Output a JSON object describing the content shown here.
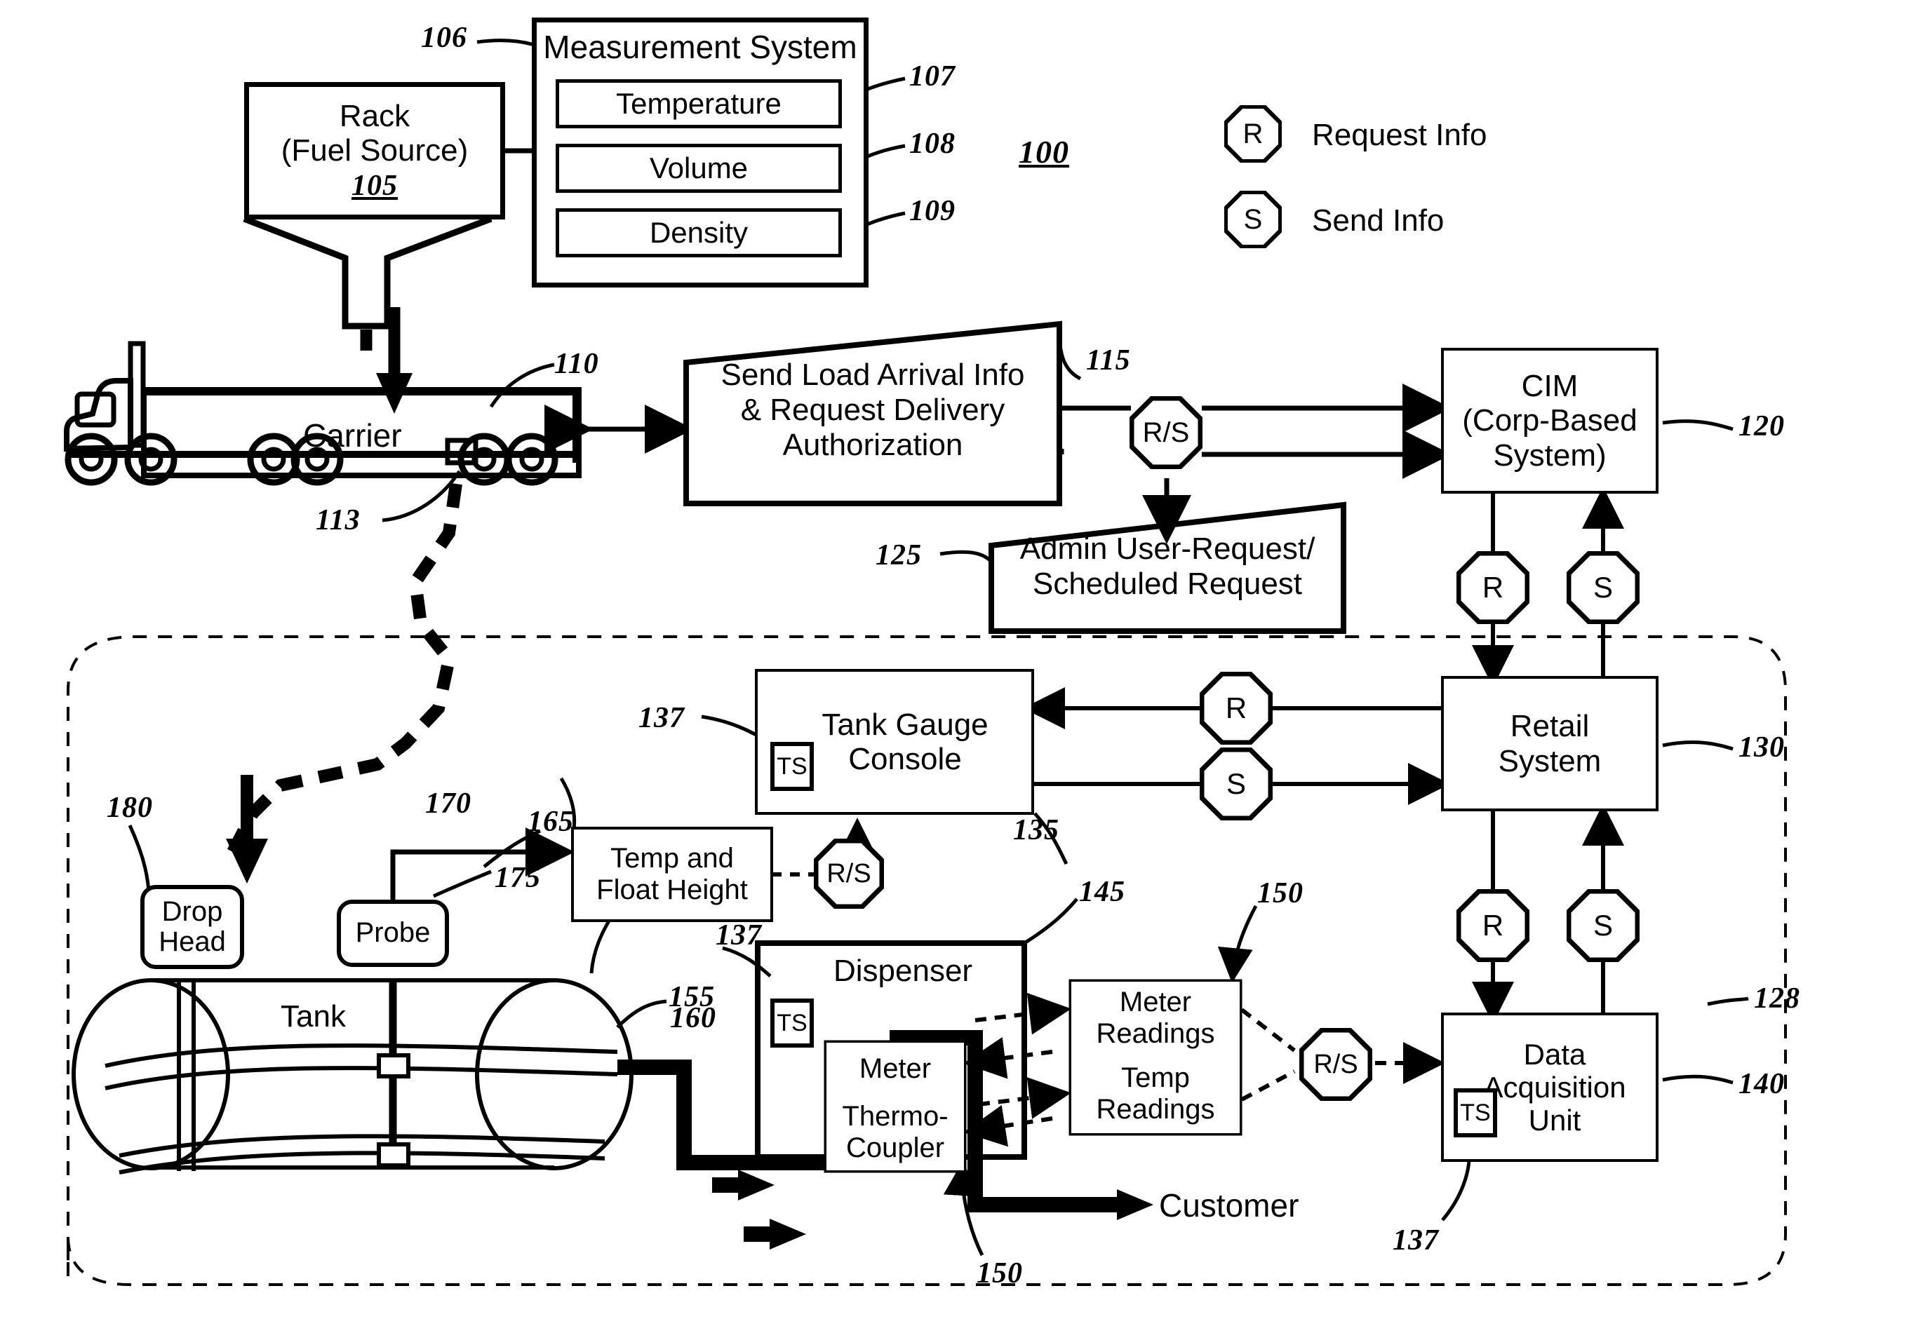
{
  "figure": {
    "number": "100",
    "legend": [
      {
        "symbol": "R",
        "label": "Request Info"
      },
      {
        "symbol": "S",
        "label": "Send Info"
      }
    ]
  },
  "nodes": {
    "rack": {
      "title": "Rack",
      "subtitle": "(Fuel Source)",
      "ref": "105"
    },
    "measurement_system": {
      "title": "Measurement System",
      "ref": "106",
      "items": [
        {
          "label": "Temperature",
          "ref": "107"
        },
        {
          "label": "Volume",
          "ref": "108"
        },
        {
          "label": "Density",
          "ref": "109"
        }
      ]
    },
    "carrier": {
      "label": "Carrier",
      "ref": "110",
      "port_ref": "113"
    },
    "send_load": {
      "line1": "Send Load Arrival Info",
      "line2": "& Request Delivery",
      "line3": "Authorization",
      "ref": "115"
    },
    "admin_request": {
      "line1": "Admin User-Request/",
      "line2": "Scheduled Request",
      "ref": "125"
    },
    "cim": {
      "line1": "CIM",
      "line2": "(Corp-Based",
      "line3": "System)",
      "ref": "120"
    },
    "retail_system": {
      "line1": "Retail",
      "line2": "System",
      "ref": "130"
    },
    "tank_gauge_console": {
      "line1": "Tank Gauge",
      "line2": "Console",
      "ref": "135",
      "ts": "TS",
      "ts_ref": "137"
    },
    "temp_float": {
      "line1": "Temp and",
      "line2": "Float Height",
      "ref": "165"
    },
    "drop_head": {
      "line1": "Drop",
      "line2": "Head",
      "ref": "180"
    },
    "probe": {
      "label": "Probe",
      "ref": "175"
    },
    "tank": {
      "label": "Tank",
      "ref": "155"
    },
    "fuel_line": {
      "ref": "160"
    },
    "delivery_path": {
      "ref": "170"
    },
    "dispenser": {
      "label": "Dispenser",
      "ref": "145",
      "ts": "TS",
      "ts_ref": "137"
    },
    "meter": {
      "label": "Meter"
    },
    "thermocoupler": {
      "line1": "Thermo-",
      "line2": "Coupler",
      "ref": "150"
    },
    "meter_readings": {
      "line1": "Meter",
      "line2": "Readings",
      "ref": "150"
    },
    "temp_readings": {
      "line1": "Temp",
      "line2": "Readings"
    },
    "data_acquisition": {
      "line1": "Data",
      "line2": "Acquisition",
      "line3": "Unit",
      "ref": "140",
      "ts": "TS",
      "ts_ref": "137"
    },
    "customer": {
      "label": "Customer"
    },
    "site_boundary": {
      "ref": "128"
    }
  },
  "connectors": {
    "carrier_to_cim": {
      "symbol": "R/S"
    },
    "temp_float_to_console": {
      "symbol": "R/S"
    },
    "dispenser_to_dau": {
      "symbol": "R/S"
    },
    "cim_retail_request": {
      "symbol": "R"
    },
    "cim_retail_send": {
      "symbol": "S"
    },
    "retail_console_request": {
      "symbol": "R"
    },
    "retail_console_send": {
      "symbol": "S"
    },
    "retail_dau_request": {
      "symbol": "R"
    },
    "retail_dau_send": {
      "symbol": "S"
    }
  }
}
